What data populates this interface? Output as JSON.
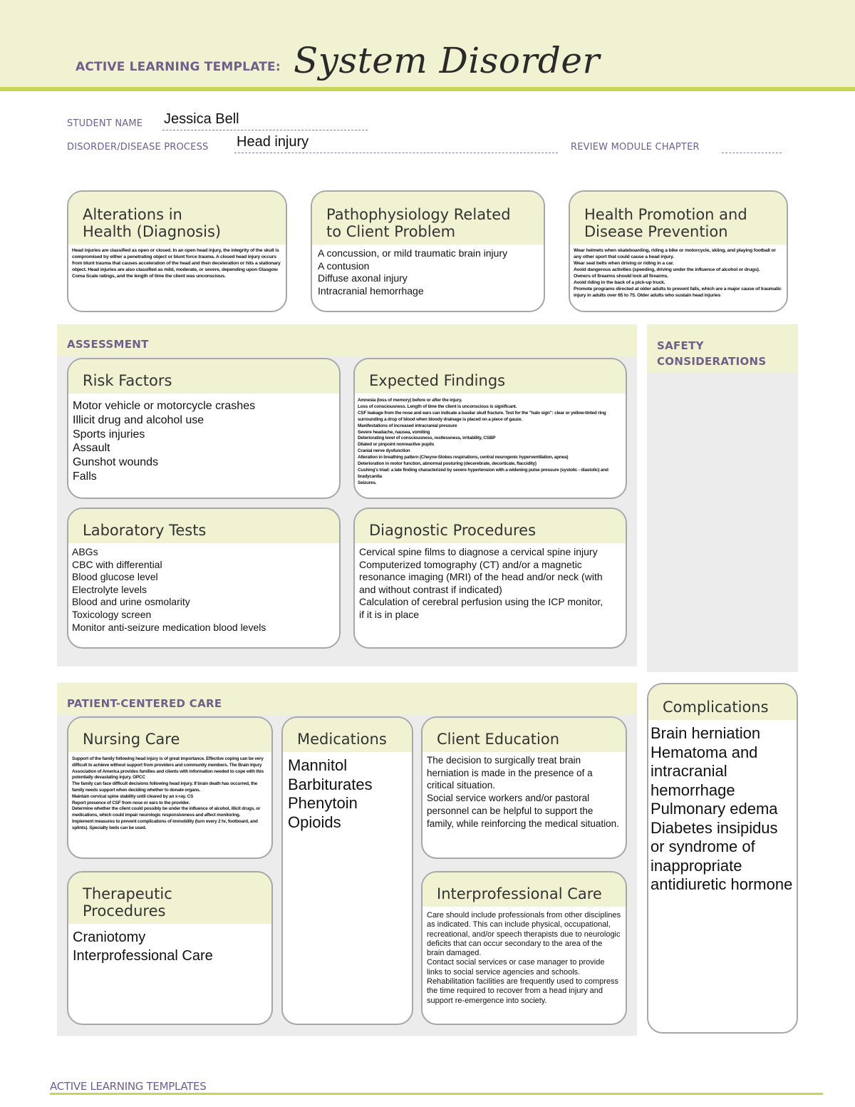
{
  "header": {
    "label": "ACTIVE LEARNING TEMPLATE:",
    "title": "System Disorder"
  },
  "fields": {
    "student_name_label": "STUDENT NAME",
    "student_name_value": "Jessica Bell",
    "disorder_label": "DISORDER/DISEASE PROCESS",
    "disorder_value": "Head injury",
    "review_label": "REVIEW MODULE CHAPTER",
    "review_value": ""
  },
  "top_boxes": {
    "alterations": {
      "title_1": "Alterations in",
      "title_2": "Health (Diagnosis)",
      "text": "Head injuries are classified as open or closed. In an open head injury, the integrity of the skull is compromised by either a penetrating object or blunt force trauma. A closed head injury occurs from blunt trauma that causes acceleration of the head and then deceleration or hits a stationary object. Head injuries are also classified as mild, moderate, or severe, depending upon Glasgow Coma Scale ratings, and the length of time the client was unconscious."
    },
    "pathophysiology": {
      "title_1": "Pathophysiology Related",
      "title_2": "to Client Problem",
      "items": [
        "A concussion, or mild traumatic brain injury",
        "A contusion",
        "Diffuse axonal injury",
        "Intracranial hemorrhage"
      ]
    },
    "health_promotion": {
      "title_1": "Health Promotion and",
      "title_2": "Disease Prevention",
      "items": [
        "Wear helmets when skateboarding, riding a bike or motorcycle, skiing, and playing football or any other sport that could cause a head injury.",
        "Wear seat belts when driving or riding in a car.",
        "Avoid dangerous activities (speeding, driving under the influence of alcohol or drugs).",
        "Owners of firearms should lock all firearms.",
        "Avoid riding in the back of a pick-up truck.",
        "Promote programs directed at older adults to prevent falls, which are a major cause of traumatic injury in adults over 65 to 75. Older adults who sustain head injuries"
      ]
    }
  },
  "assessment": {
    "section_title": "ASSESSMENT",
    "risk_factors": {
      "title": "Risk Factors",
      "items": [
        "Motor vehicle or motorcycle crashes",
        "Illicit drug and alcohol use",
        "Sports injuries",
        "Assault",
        "Gunshot wounds",
        "Falls"
      ]
    },
    "expected_findings": {
      "title": "Expected Findings",
      "items": [
        "Amnesia (loss of memory) before or after the injury.",
        "Loss of consciousness. Length of time the client is unconscious is significant.",
        "CSF leakage from the nose and ears can indicate a basilar skull fracture. Test for the \"halo sign\": clear or yellow-tinted ring surrounding a drop of blood when bloody drainage is placed on a piece of gauze.",
        "Manifestations of increased intracranial pressure",
        "Severe headache, nausea, vomiting",
        "Deteriorating level of consciousness, restlessness, irritability, CSBP",
        "Dilated or pinpoint nonreactive pupils",
        "Cranial nerve dysfunction",
        "Alteration in breathing pattern (Cheyne-Stokes respirations, central neurogenic hyperventilation, apnea)",
        "Deterioration in motor function, abnormal posturing (decerebrate, decorticate, flaccidity)",
        "Cushing's triad: a late finding characterized by severe hypertension with a widening pulse pressure (systolic - diastolic) and bradycardia",
        "Seizures."
      ]
    },
    "laboratory_tests": {
      "title": "Laboratory Tests",
      "items": [
        "ABGs",
        "CBC with differential",
        "Blood glucose level",
        "Electrolyte levels",
        "Blood and urine osmolarity",
        "Toxicology screen",
        "Monitor anti-seizure medication blood levels"
      ]
    },
    "diagnostic_procedures": {
      "title": "Diagnostic Procedures",
      "items": [
        "Cervical spine films to diagnose a cervical spine injury",
        "Computerized tomography (CT) and/or a magnetic resonance imaging (MRI) of the head and/or neck (with and without contrast if indicated)",
        "Calculation of cerebral perfusion using the ICP monitor, if it is in place"
      ]
    }
  },
  "safety": {
    "title_1": "SAFETY",
    "title_2": "CONSIDERATIONS"
  },
  "patient_centered_care": {
    "section_title": "PATIENT-CENTERED CARE",
    "nursing_care": {
      "title": "Nursing Care",
      "items": [
        "Support of the family following head injury is of great importance. Effective coping can be very difficult to achieve without support from providers and community members. The Brain Injury Association of America provides families and clients with information needed to cope with this potentially devastating injury. OPCC",
        "The family can face difficult decisions following head injury. If brain death has occurred, the family needs support when deciding whether to donate organs.",
        "Maintain cervical spine stability until cleared by an x-ray. CS",
        "Report presence of CSF from nose or ears to the provider.",
        "Determine whether the client could possibly be under the influence of alcohol, illicit drugs, or medications, which could impair neurologic responsiveness and affect monitoring.",
        "Implement measures to prevent complications of immobility (turn every 2 hr, footboard, and splints). Specialty beds can be used."
      ]
    },
    "medications": {
      "title": "Medications",
      "items": [
        "Mannitol",
        "Barbiturates",
        "Phenytoin",
        "Opioids"
      ]
    },
    "client_education": {
      "title": "Client Education",
      "items": [
        "The decision to surgically treat brain herniation is made in the presence of a critical situation.",
        "Social service workers and/or pastoral personnel can be helpful to support the family, while reinforcing the medical situation."
      ]
    },
    "therapeutic_procedures": {
      "title": "Therapeutic Procedures",
      "items": [
        "Craniotomy",
        "Interprofessional Care"
      ]
    },
    "interprofessional_care": {
      "title": "Interprofessional Care",
      "items": [
        "Care should include professionals from other disciplines as indicated. This can include physical, occupational, recreational, and/or speech therapists due to neurologic deficits that can occur secondary to the area of the brain damaged.",
        "Contact social services or case manager to provide links to social service agencies and schools.",
        "Rehabilitation facilities are frequently used to compress the time required to recover from a head injury and support re-emergence into society."
      ]
    }
  },
  "complications": {
    "title": "Complications",
    "items": [
      "Brain herniation",
      "Hematoma and intracranial hemorrhage",
      "Pulmonary edema",
      "Diabetes insipidus or syndrome of inappropriate antidiuretic hormone"
    ]
  },
  "footer": {
    "label": "ACTIVE LEARNING TEMPLATES"
  }
}
